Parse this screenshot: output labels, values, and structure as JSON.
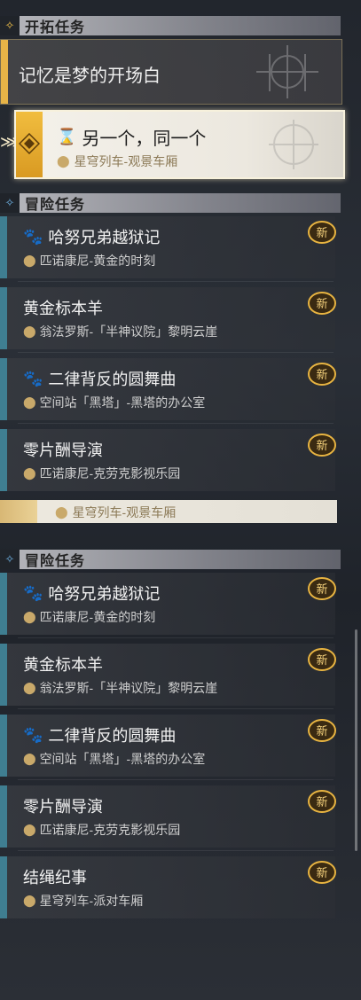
{
  "screen_top": {
    "trailblaze_header": "开拓任务",
    "main_quest_title": "记忆是梦的开场白",
    "active_quest": {
      "title": "另一个，同一个",
      "location": "星穹列车-观景车厢"
    },
    "adventure_header": "冒险任务",
    "quests": [
      {
        "title": "哈努兄弟越狱记",
        "location": "匹诺康尼-黄金的时刻",
        "badge": "新",
        "has_pet_icon": true
      },
      {
        "title": "黄金标本羊",
        "location": "翁法罗斯-「半神议院」黎明云崖",
        "badge": "新",
        "has_pet_icon": false
      },
      {
        "title": "二律背反的圆舞曲",
        "location": "空间站「黑塔」-黑塔的办公室",
        "badge": "新",
        "has_pet_icon": true
      },
      {
        "title": "零片酬导演",
        "location": "匹诺康尼-克劳克影视乐园",
        "badge": "新",
        "has_pet_icon": false
      }
    ]
  },
  "screen_bottom": {
    "partial_location": "星穹列车-观景车厢",
    "adventure_header": "冒险任务",
    "quests": [
      {
        "title": "哈努兄弟越狱记",
        "location": "匹诺康尼-黄金的时刻",
        "badge": "新",
        "has_pet_icon": true
      },
      {
        "title": "黄金标本羊",
        "location": "翁法罗斯-「半神议院」黎明云崖",
        "badge": "新",
        "has_pet_icon": false
      },
      {
        "title": "二律背反的圆舞曲",
        "location": "空间站「黑塔」-黑塔的办公室",
        "badge": "新",
        "has_pet_icon": true
      },
      {
        "title": "零片酬导演",
        "location": "匹诺康尼-克劳克影视乐园",
        "badge": "新",
        "has_pet_icon": false
      },
      {
        "title": "结绳纪事",
        "location": "星穹列车-派对车厢",
        "badge": "新",
        "has_pet_icon": false
      }
    ]
  },
  "colors": {
    "accent_gold": "#e7b447",
    "adventure_bar": "#3f7e91",
    "location_pin": "#c9a96a"
  }
}
